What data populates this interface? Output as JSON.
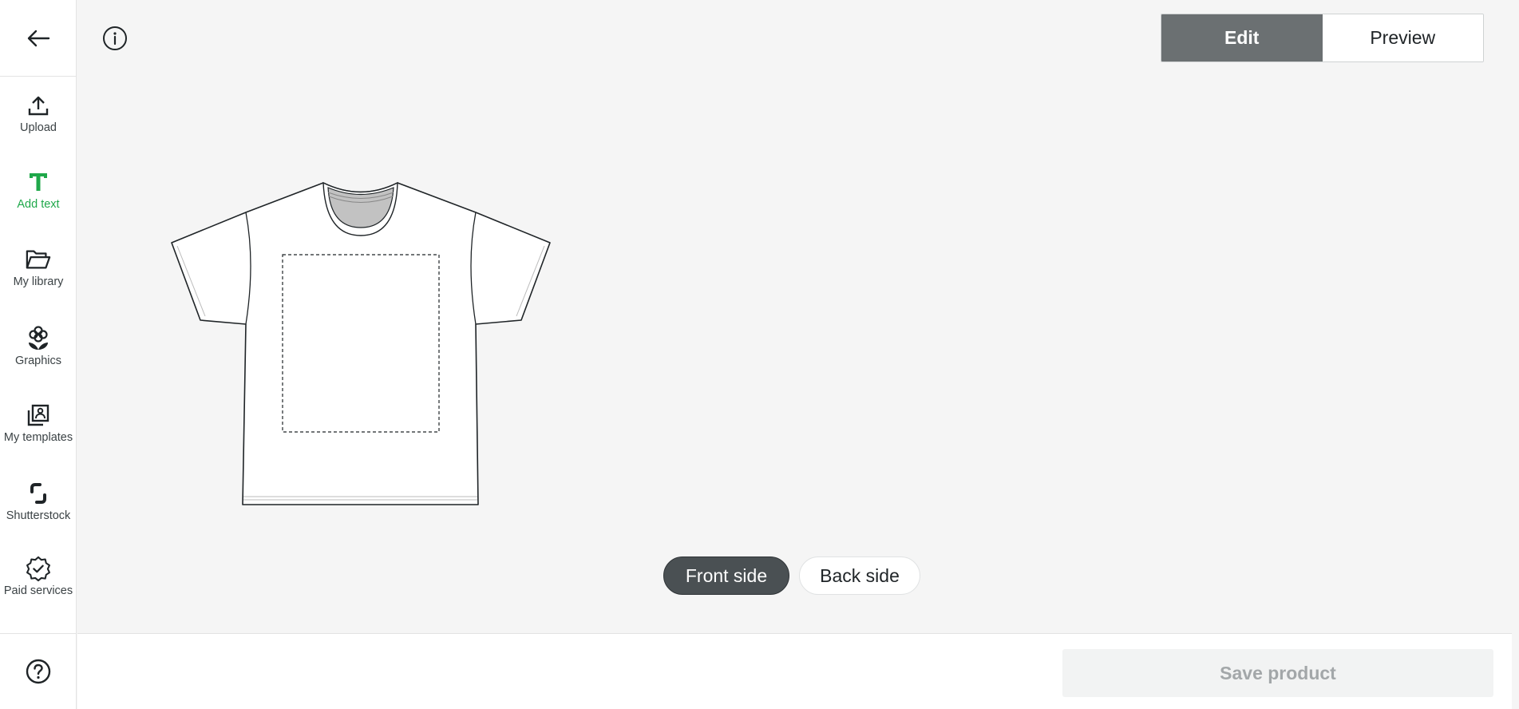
{
  "sidebar": {
    "items": [
      {
        "label": "Upload",
        "icon": "upload-icon"
      },
      {
        "label": "Add text",
        "icon": "text-icon",
        "active": true
      },
      {
        "label": "My library",
        "icon": "folder-icon"
      },
      {
        "label": "Graphics",
        "icon": "flower-icon"
      },
      {
        "label": "My templates",
        "icon": "templates-icon"
      },
      {
        "label": "Shutterstock",
        "icon": "shutterstock-icon"
      },
      {
        "label": "Paid services",
        "icon": "badge-check-icon"
      }
    ]
  },
  "header": {
    "mode": {
      "edit_label": "Edit",
      "preview_label": "Preview",
      "selected": "Edit"
    }
  },
  "product": {
    "sides": {
      "front_label": "Front side",
      "back_label": "Back side",
      "selected": "Front side"
    }
  },
  "footer": {
    "save_label": "Save product"
  },
  "colors": {
    "accent_green": "#1fa84a",
    "toggle_active": "#6b7072",
    "side_active": "#4a5053",
    "background": "#f5f5f5"
  }
}
